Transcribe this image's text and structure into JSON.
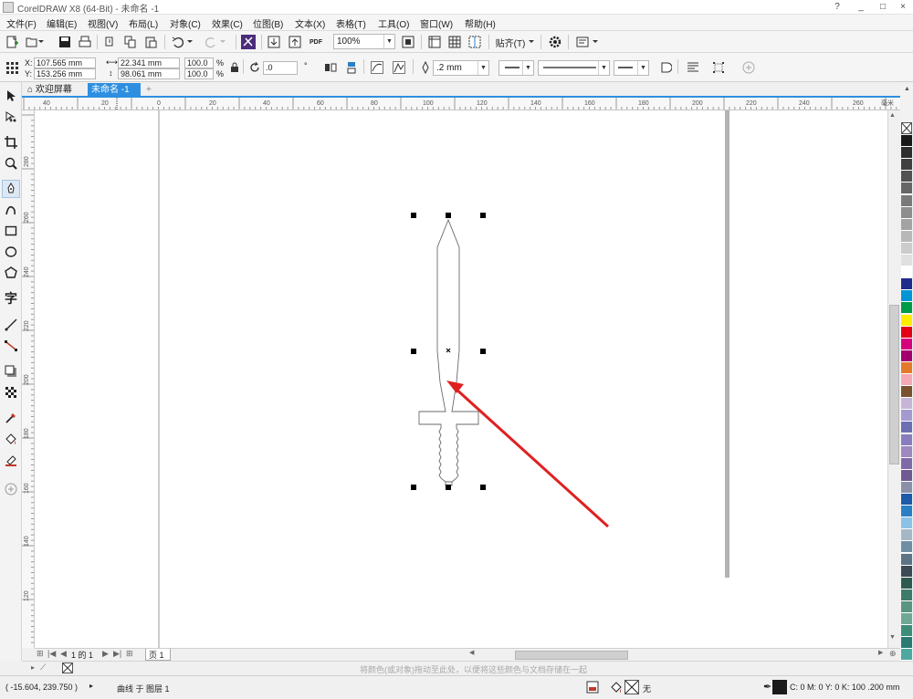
{
  "window": {
    "title": "CorelDRAW X8 (64-Bit) - 未命名 -1",
    "controls": [
      "?",
      "_",
      "□",
      "×"
    ]
  },
  "menu": [
    "文件(F)",
    "编辑(E)",
    "视图(V)",
    "布局(L)",
    "对象(C)",
    "效果(C)",
    "位图(B)",
    "文本(X)",
    "表格(T)",
    "工具(O)",
    "窗口(W)",
    "帮助(H)"
  ],
  "toolbar": {
    "zoom": "100%",
    "snap_label": "贴齐(T)",
    "pdf_label": "PDF"
  },
  "propbar": {
    "x": "107.565 mm",
    "y": "153.256 mm",
    "width": "22.341 mm",
    "height": "98.061 mm",
    "scale_x": "100.0",
    "scale_y": "100.0",
    "percent": "%",
    "rotation": ".0",
    "outline_width": ".2 mm",
    "x_label": "X:",
    "y_label": "Y:"
  },
  "tabs": {
    "welcome": "欢迎屏幕",
    "document": "未命名 -1",
    "close": "×",
    "add": "+"
  },
  "hruler": {
    "unit": "毫米",
    "ticks": [
      "40",
      "20",
      "0",
      "20",
      "40",
      "60",
      "80",
      "100",
      "120",
      "140",
      "160",
      "180",
      "200",
      "220",
      "240",
      "260"
    ]
  },
  "vruler": {
    "ticks": [
      "280",
      "260",
      "240",
      "220",
      "200",
      "180",
      "160",
      "140",
      "120",
      "100",
      "80",
      "60"
    ]
  },
  "pagenav": {
    "page_count": "1 的 1",
    "page_tab": "页 1"
  },
  "docpalette_hint": "将颜色(或对象)拖动至此处，以便将这些颜色与文档存储在一起",
  "status": {
    "coords": "( -15.604, 239.750 )",
    "object_info": "曲线 于 图层 1",
    "fill_label": "无",
    "outline_info": "C: 0 M: 0 Y: 0 K: 100  .200 mm"
  },
  "palette_colors": [
    "#1a1a1a",
    "#2e2e2e",
    "#404040",
    "#535353",
    "#666666",
    "#7a7a7a",
    "#8e8e8e",
    "#a3a3a3",
    "#b8b8b8",
    "#cccccc",
    "#e0e0e0",
    "#ffffff",
    "#1f2e8c",
    "#0096d6",
    "#009b48",
    "#ffec00",
    "#e30016",
    "#d6007e",
    "#a4006d",
    "#e5792a",
    "#f4a9b4",
    "#7a5230",
    "#c7b5d8",
    "#a49ad0",
    "#6d6fb3",
    "#8a7dbd",
    "#9d88c0",
    "#7f6aa9",
    "#6f5a94",
    "#8c8fa8",
    "#1d5aa8",
    "#2a7fc4",
    "#8cc2e6",
    "#a5b8c8",
    "#6f8ea3",
    "#5d7487",
    "#3c4a55",
    "#2f5b4f",
    "#407a6a",
    "#5a9582",
    "#6fa894",
    "#3d8d7a",
    "#2c7a72",
    "#4fa8a0",
    "#6dbdb5",
    "#8fd0c9"
  ]
}
